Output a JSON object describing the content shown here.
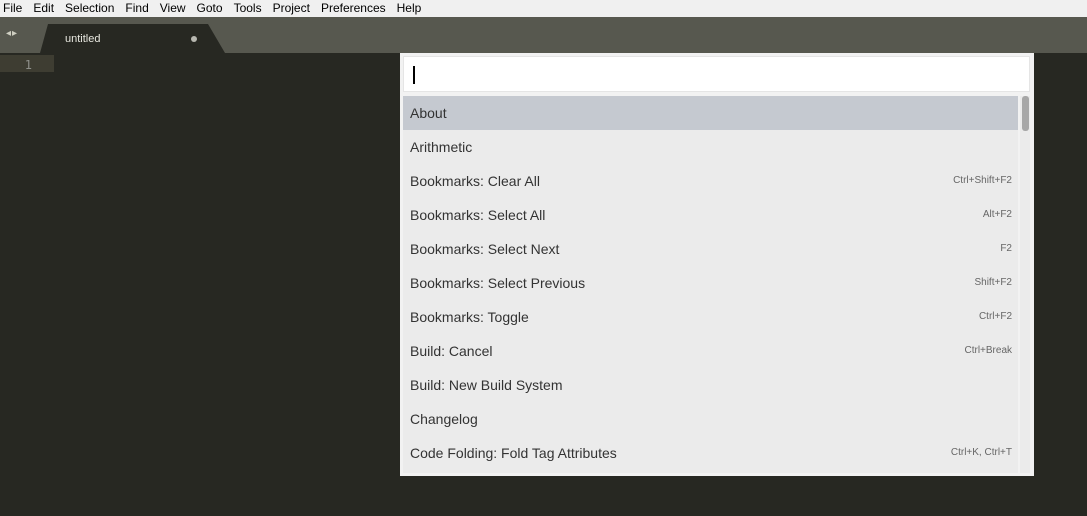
{
  "menubar": {
    "items": [
      "File",
      "Edit",
      "Selection",
      "Find",
      "View",
      "Goto",
      "Tools",
      "Project",
      "Preferences",
      "Help"
    ]
  },
  "tabbar": {
    "nav_icon": "◂▸",
    "tabs": [
      {
        "label": "untitled",
        "modified": true
      }
    ]
  },
  "editor": {
    "line_numbers": [
      "1"
    ]
  },
  "palette": {
    "input_value": "",
    "items": [
      {
        "label": "About",
        "shortcut": "",
        "selected": true
      },
      {
        "label": "Arithmetic",
        "shortcut": ""
      },
      {
        "label": "Bookmarks: Clear All",
        "shortcut": "Ctrl+Shift+F2"
      },
      {
        "label": "Bookmarks: Select All",
        "shortcut": "Alt+F2"
      },
      {
        "label": "Bookmarks: Select Next",
        "shortcut": "F2"
      },
      {
        "label": "Bookmarks: Select Previous",
        "shortcut": "Shift+F2"
      },
      {
        "label": "Bookmarks: Toggle",
        "shortcut": "Ctrl+F2"
      },
      {
        "label": "Build: Cancel",
        "shortcut": "Ctrl+Break"
      },
      {
        "label": "Build: New Build System",
        "shortcut": ""
      },
      {
        "label": "Changelog",
        "shortcut": ""
      },
      {
        "label": "Code Folding: Fold Tag Attributes",
        "shortcut": "Ctrl+K, Ctrl+T"
      }
    ]
  },
  "colors": {
    "editor_bg": "#272822",
    "tabbar_bg": "#57584f",
    "palette_bg": "#ebebeb",
    "selected_row": "#c5c9d0"
  }
}
